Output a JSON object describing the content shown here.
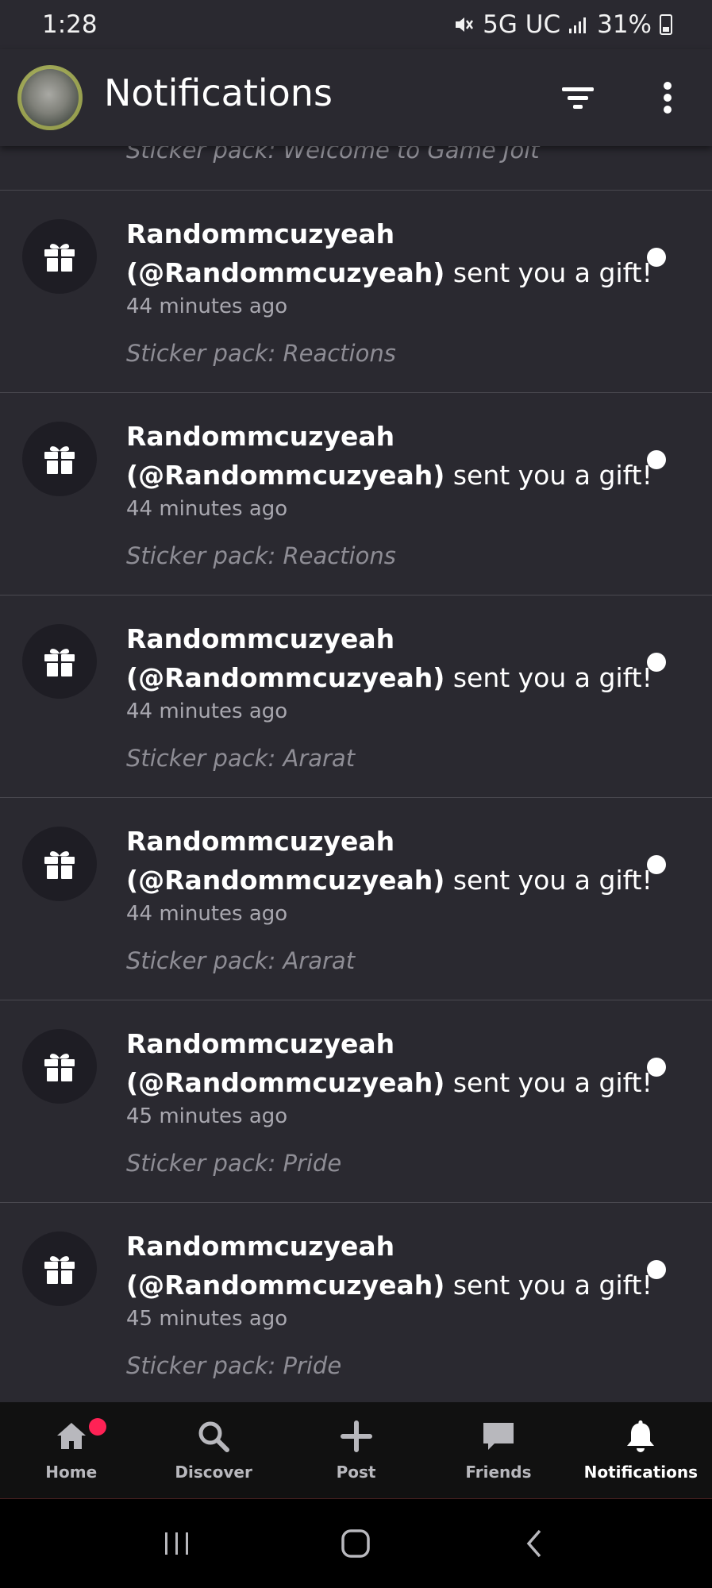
{
  "status_bar": {
    "time": "1:28",
    "network": "5G UC",
    "battery": "31%"
  },
  "app_bar": {
    "title": "Notifications",
    "icons": [
      "filter-icon",
      "more-vert-icon"
    ]
  },
  "notifications": {
    "partial_top_subtext": "Sticker pack: Welcome to Game Jolt",
    "items": [
      {
        "user": "Randommcuzyeah",
        "handle": "(@Randommcuzyeah)",
        "action": " sent you a gift!",
        "time": "44 minutes ago",
        "subtext": "Sticker pack: Reactions",
        "unread": true
      },
      {
        "user": "Randommcuzyeah",
        "handle": "(@Randommcuzyeah)",
        "action": " sent you a gift!",
        "time": "44 minutes ago",
        "subtext": "Sticker pack: Reactions",
        "unread": true
      },
      {
        "user": "Randommcuzyeah",
        "handle": "(@Randommcuzyeah)",
        "action": " sent you a gift!",
        "time": "44 minutes ago",
        "subtext": "Sticker pack: Ararat",
        "unread": true
      },
      {
        "user": "Randommcuzyeah",
        "handle": "(@Randommcuzyeah)",
        "action": " sent you a gift!",
        "time": "44 minutes ago",
        "subtext": "Sticker pack: Ararat",
        "unread": true
      },
      {
        "user": "Randommcuzyeah",
        "handle": "(@Randommcuzyeah)",
        "action": " sent you a gift!",
        "time": "45 minutes ago",
        "subtext": "Sticker pack: Pride",
        "unread": true
      },
      {
        "user": "Randommcuzyeah",
        "handle": "(@Randommcuzyeah)",
        "action": " sent you a gift!",
        "time": "45 minutes ago",
        "subtext": "Sticker pack: Pride",
        "unread": true
      }
    ]
  },
  "bottom_nav": {
    "items": [
      {
        "label": "Home",
        "icon": "home-icon",
        "badge": true,
        "active": false
      },
      {
        "label": "Discover",
        "icon": "search-icon",
        "badge": false,
        "active": false
      },
      {
        "label": "Post",
        "icon": "plus-icon",
        "badge": false,
        "active": false
      },
      {
        "label": "Friends",
        "icon": "chat-icon",
        "badge": false,
        "active": false
      },
      {
        "label": "Notifications",
        "icon": "bell-icon",
        "badge": false,
        "active": true
      }
    ]
  },
  "colors": {
    "background": "#2a2930",
    "icon_circle": "#1e1d24",
    "divider": "#4a4950",
    "badge": "#ff2255",
    "nav_background": "#111111"
  }
}
